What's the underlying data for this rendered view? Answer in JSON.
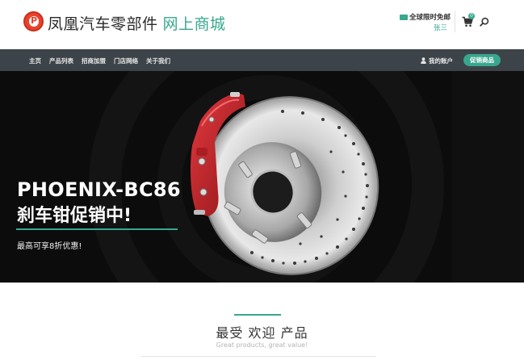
{
  "header": {
    "brand_main": "凤凰汽车零部件",
    "brand_sub": "网上商城",
    "shipping_text": "全球限时免邮",
    "user_name": "张三",
    "cart_count": "0"
  },
  "nav": {
    "items": [
      {
        "label": "主页"
      },
      {
        "label": "产品列表"
      },
      {
        "label": "招商加盟"
      },
      {
        "label": "门店网络"
      },
      {
        "label": "关于我们"
      }
    ],
    "account_label": "我的账户",
    "promo_label": "促销商品"
  },
  "hero": {
    "title": "PHOENIX-BC86",
    "subtitle": "刹车钳促销中!",
    "note": "最高可享8折优惠!"
  },
  "section": {
    "title": "最受 欢迎 产品",
    "subtitle": "Great products, great value!"
  },
  "colors": {
    "accent": "#37a78e",
    "nav_bg": "#3d4449",
    "hero_bg": "#0c0c0c",
    "caliper": "#c8252b",
    "logo_red": "#e8422d"
  },
  "icons": [
    "logo-icon",
    "truck-icon",
    "cart-icon",
    "search-icon",
    "user-icon"
  ]
}
